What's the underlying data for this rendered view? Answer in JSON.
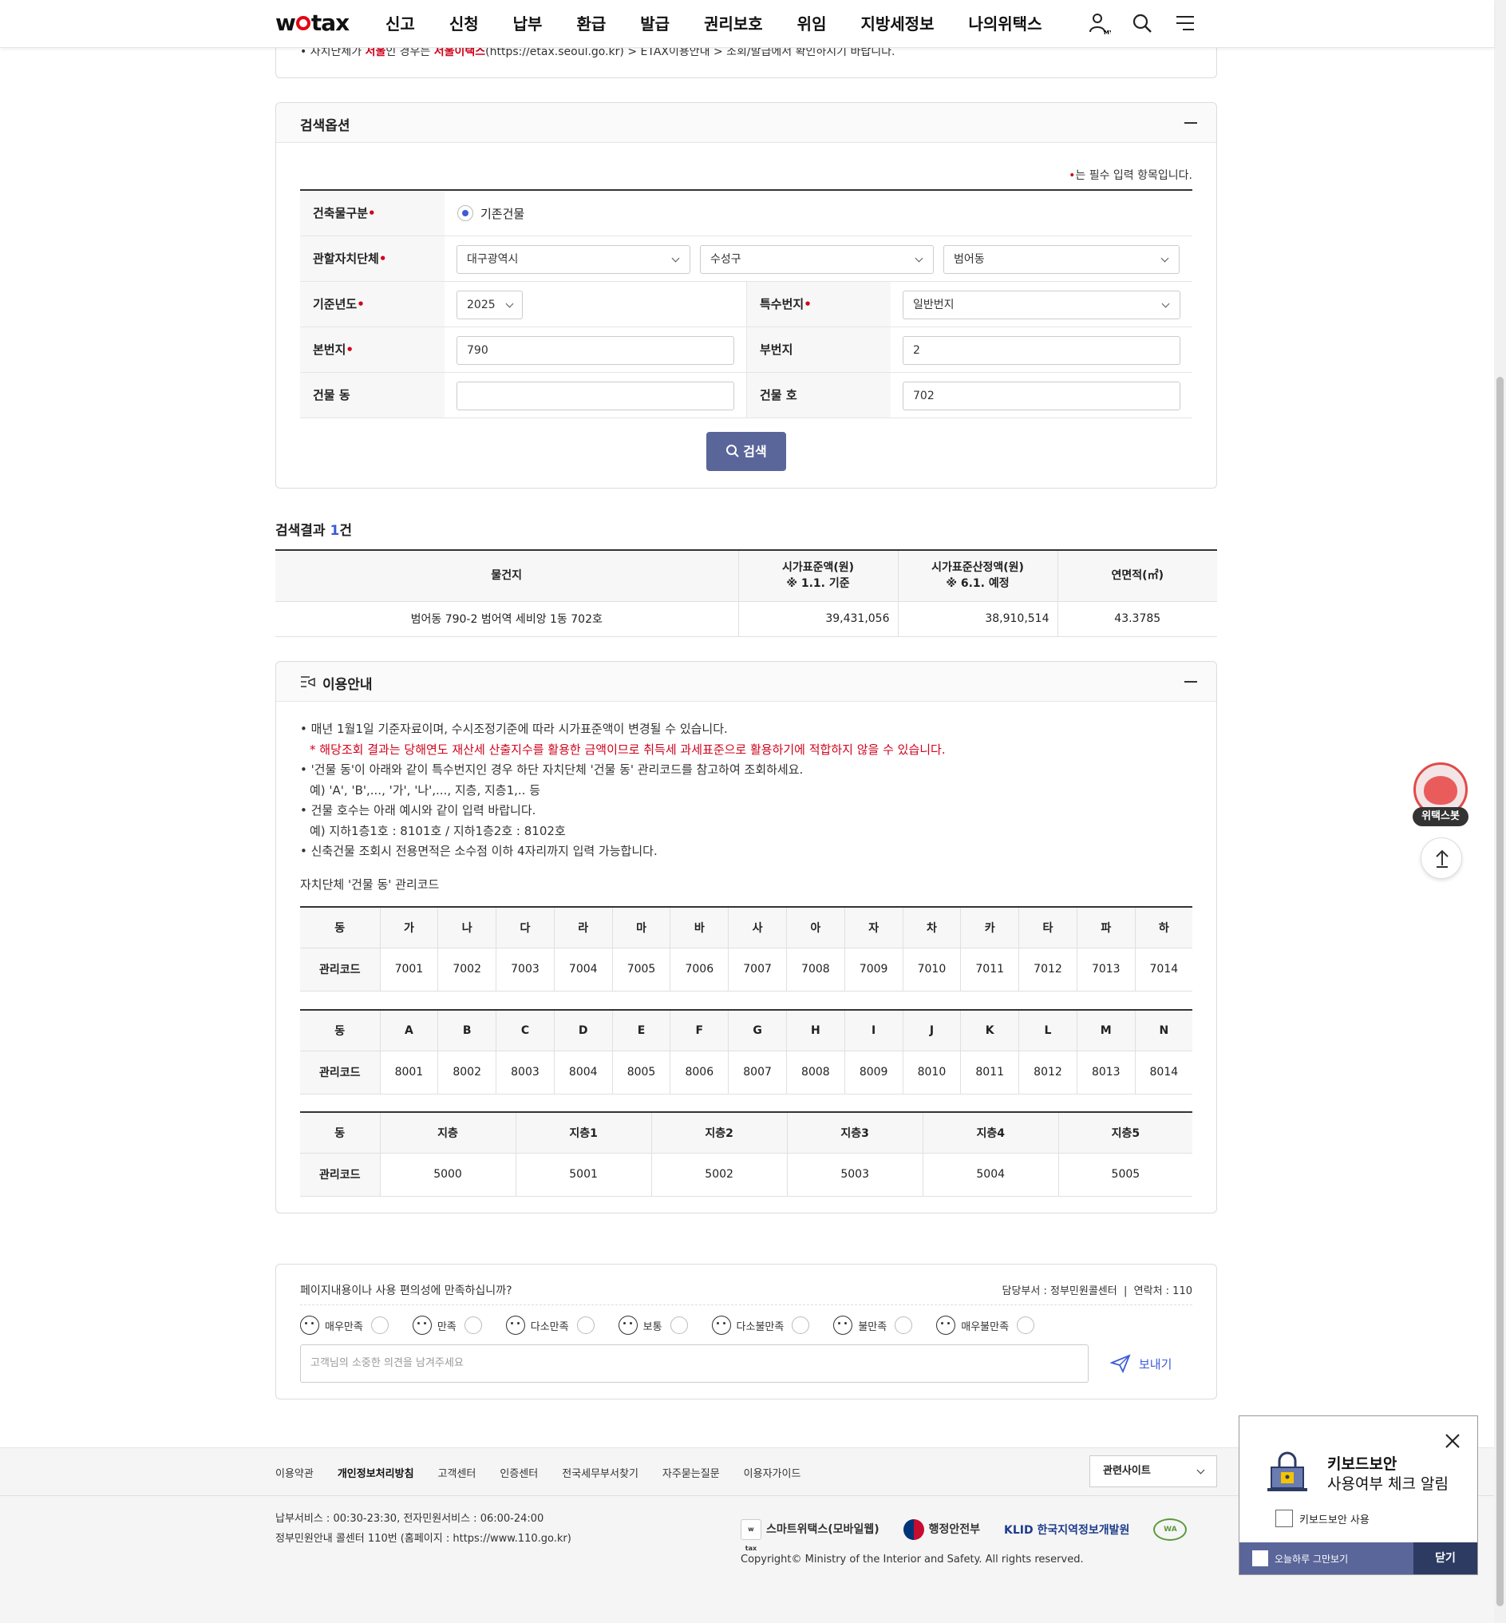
{
  "header": {
    "logo_pre": "w",
    "logo_post": "tax",
    "nav": [
      "신고",
      "신청",
      "납부",
      "환급",
      "발급",
      "권리보호",
      "위임",
      "지방세정보",
      "나의위택스"
    ],
    "my_label": "MY",
    "icons": [
      "user-my-icon",
      "search-icon",
      "menu-icon"
    ]
  },
  "notice_top": {
    "pre": "• 자치단체가 ",
    "city": "서울",
    "mid": "인 경우는 ",
    "site": "서울이택스",
    "post": "(https://etax.seoul.go.kr) > ETAX이용안내 > 조회/발급에서 확인하시기 바랍니다."
  },
  "search_options": {
    "title": "검색옵션",
    "required_note": "는 필수 입력 항목입니다.",
    "required_mark": "•",
    "labels": {
      "building_type": "건축물구분",
      "jurisdiction": "관할자치단체",
      "base_year": "기준년도",
      "special_lot": "특수번지",
      "main_lot": "본번지",
      "sub_lot": "부번지",
      "building_dong": "건물 동",
      "building_ho": "건물 호"
    },
    "building_type_value": "기존건물",
    "sido": "대구광역시",
    "sigungu": "수성구",
    "dong": "범어동",
    "year": "2025",
    "special_lot_value": "일반번지",
    "main_lot_value": "790",
    "sub_lot_value": "2",
    "building_dong_value": "",
    "building_ho_value": "702",
    "search_button": "검색"
  },
  "results": {
    "title_pre": "검색결과 ",
    "count": "1",
    "title_post": "건",
    "columns": [
      {
        "line1": "물건지",
        "line2": ""
      },
      {
        "line1": "시가표준액(원)",
        "line2": "※ 1.1. 기준"
      },
      {
        "line1": "시가표준산정액(원)",
        "line2": "※ 6.1. 예정"
      },
      {
        "line1": "연면적(㎡)",
        "line2": ""
      }
    ],
    "rows": [
      {
        "address": "범어동 790-2 범어역 세비앙 1동 702호",
        "standard": "39,431,056",
        "estimated": "38,910,514",
        "area": "43.3785"
      }
    ]
  },
  "guide": {
    "title": "이용안내",
    "lines": [
      "• 매년 1월1일 기준자료이며, 수시조정기준에 따라 시가표준액이 변경될 수 있습니다.",
      "* 해당조회 결과는 당해연도 재산세 산출지수를 활용한 금액이므로 취득세 과세표준으로 활용하기에 적합하지 않을 수 있습니다.",
      "• '건물 동'이 아래와 같이 특수번지인 경우 하단 자치단체 '건물 동' 관리코드를 참고하여 조회하세요.",
      "예) 'A', 'B',..., '가', '나',..., 지층, 지층1,.. 등",
      "• 건물 호수는 아래 예시와 같이 입력 바랍니다.",
      "예) 지하1층1호 : 8101호 / 지하1층2호 : 8102호",
      "• 신축건물 조회시 전용면적은 소수점 이하 4자리까지 입력 가능합니다."
    ],
    "code_caption": "자치단체 '건물 동' 관리코드",
    "row_head_dong": "동",
    "row_head_code": "관리코드",
    "table1": {
      "dongs": [
        "가",
        "나",
        "다",
        "라",
        "마",
        "바",
        "사",
        "아",
        "자",
        "차",
        "카",
        "타",
        "파",
        "하"
      ],
      "codes": [
        "7001",
        "7002",
        "7003",
        "7004",
        "7005",
        "7006",
        "7007",
        "7008",
        "7009",
        "7010",
        "7011",
        "7012",
        "7013",
        "7014"
      ]
    },
    "table2": {
      "dongs": [
        "A",
        "B",
        "C",
        "D",
        "E",
        "F",
        "G",
        "H",
        "I",
        "J",
        "K",
        "L",
        "M",
        "N"
      ],
      "codes": [
        "8001",
        "8002",
        "8003",
        "8004",
        "8005",
        "8006",
        "8007",
        "8008",
        "8009",
        "8010",
        "8011",
        "8012",
        "8013",
        "8014"
      ]
    },
    "table3": {
      "dongs": [
        "지층",
        "지층1",
        "지층2",
        "지층3",
        "지층4",
        "지층5"
      ],
      "codes": [
        "5000",
        "5001",
        "5002",
        "5003",
        "5004",
        "5005"
      ]
    }
  },
  "feedback": {
    "question": "페이지내용이나 사용 편의성에 만족하십니까?",
    "dept": "담당부서 : 정부민원콜센터",
    "contact": "연락처 : 110",
    "options": [
      "매우만족",
      "만족",
      "다소만족",
      "보통",
      "다소불만족",
      "불만족",
      "매우불만족"
    ],
    "placeholder": "고객님의 소중한 의견을 남겨주세요",
    "send": "보내기"
  },
  "footer": {
    "links": [
      "이용약관",
      "개인정보처리방침",
      "고객센터",
      "인증센터",
      "전국세무부서찾기",
      "자주묻는질문",
      "이용자가이드"
    ],
    "related_sites": "관련사이트",
    "info1": "납부서비스 : 00:30-23:30, 전자민원서비스 : 06:00-24:00",
    "info2": "정부민원안내 콜센터 110번 (홈페이지 : https://www.110.go.kr)",
    "logos": [
      "스마트위택스(모바일웹)",
      "행정안전부",
      "KLID 한국지역정보개발원"
    ],
    "smart_mark": "w tax",
    "wa_mark": "WA",
    "copyright": "Copyright© Ministry of the Interior and Safety. All rights reserved."
  },
  "floating": {
    "chatbot": "위택스봇"
  },
  "keyboard_popup": {
    "title1": "키보드보안",
    "title2": "사용여부 체크 알림",
    "checkbox": "키보드보안 사용",
    "today": "오늘하루 그만보기",
    "close": "닫기"
  }
}
